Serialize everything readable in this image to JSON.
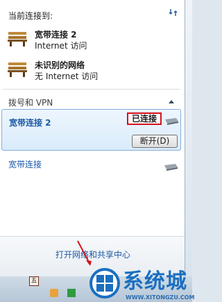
{
  "header": {
    "title": "当前连接到:"
  },
  "connections": [
    {
      "name": "宽带连接 2",
      "access": "Internet 访问"
    },
    {
      "name": "未识别的网络",
      "access": "无 Internet 访问"
    }
  ],
  "dialup_section": {
    "title": "拨号和 VPN",
    "items": [
      {
        "name": "宽带连接 2",
        "status": "已连接",
        "button": "断开(D)"
      },
      {
        "name": "宽带连接"
      }
    ]
  },
  "footer": {
    "link": "打开网络和共享中心"
  },
  "tray": {
    "badge": "五"
  },
  "watermark": {
    "brand": "系统城",
    "url": "WWW.XITONGZU.COM"
  }
}
